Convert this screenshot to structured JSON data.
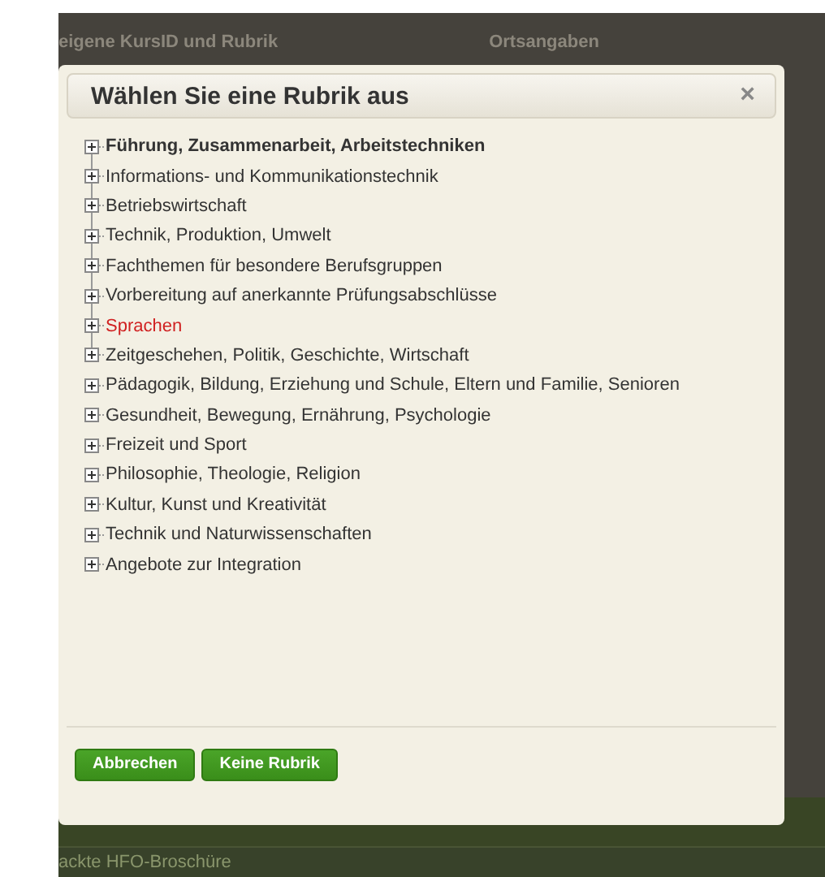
{
  "background": {
    "legends": [
      "eigene KursID und Rubrik",
      "Ortsangaben"
    ],
    "footer_rows": [
      "ackte HFO-Broschüre"
    ]
  },
  "dialog": {
    "title": "Wählen Sie eine Rubrik aus",
    "close": "×",
    "tree": [
      {
        "label": "Führung, Zusammenarbeit, Arbeitstechniken",
        "focused": true,
        "selected": false
      },
      {
        "label": "Informations- und Kommunikationstechnik",
        "focused": false,
        "selected": false
      },
      {
        "label": "Betriebswirtschaft",
        "focused": false,
        "selected": false
      },
      {
        "label": "Technik, Produktion, Umwelt",
        "focused": false,
        "selected": false
      },
      {
        "label": "Fachthemen für besondere Berufsgruppen",
        "focused": false,
        "selected": false
      },
      {
        "label": "Vorbereitung auf anerkannte Prüfungsabschlüsse",
        "focused": false,
        "selected": false
      },
      {
        "label": "Sprachen",
        "focused": false,
        "selected": true
      },
      {
        "label": "Zeitgeschehen, Politik, Geschichte, Wirtschaft",
        "focused": false,
        "selected": false
      },
      {
        "label": "Pädagogik, Bildung, Erziehung und Schule, Eltern und Familie, Senioren",
        "focused": false,
        "selected": false
      },
      {
        "label": "Gesundheit, Bewegung, Ernährung, Psychologie",
        "focused": false,
        "selected": false
      },
      {
        "label": "Freizeit und Sport",
        "focused": false,
        "selected": false
      },
      {
        "label": "Philosophie, Theologie, Religion",
        "focused": false,
        "selected": false
      },
      {
        "label": "Kultur, Kunst und Kreativität",
        "focused": false,
        "selected": false
      },
      {
        "label": "Technik und Naturwissenschaften",
        "focused": false,
        "selected": false
      },
      {
        "label": "Angebote zur Integration",
        "focused": false,
        "selected": false
      }
    ],
    "buttons": [
      "Abbrechen",
      "Keine Rubrik"
    ]
  }
}
